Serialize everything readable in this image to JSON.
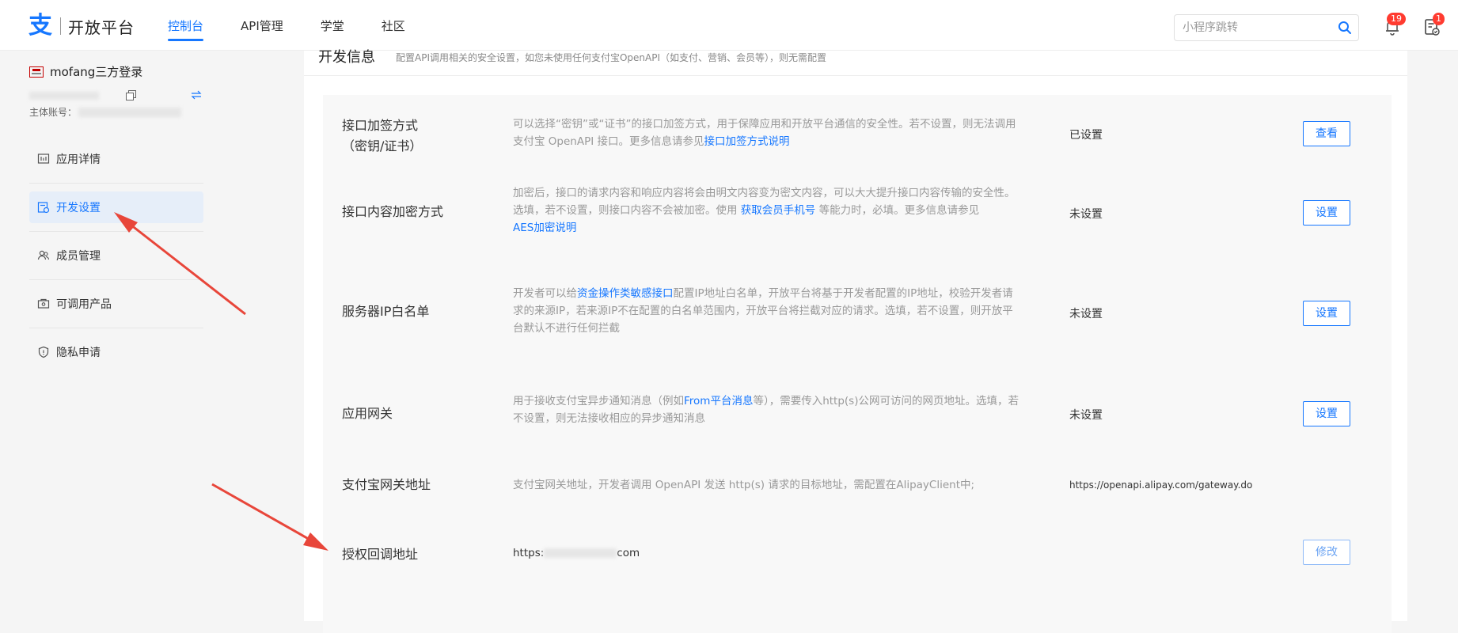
{
  "header": {
    "logo_mark": "支",
    "logo_text": "开放平台",
    "nav": [
      {
        "label": "控制台",
        "active": true
      },
      {
        "label": "API管理",
        "active": false
      },
      {
        "label": "学堂",
        "active": false
      },
      {
        "label": "社区",
        "active": false
      }
    ],
    "search_placeholder": "小程序跳转",
    "notification_count": "19",
    "todo_count": "1"
  },
  "sidebar": {
    "app_name": "mofang三方登录",
    "main_account_label": "主体账号：",
    "menu": [
      {
        "label": "应用详情",
        "icon": "app-detail-icon",
        "active": false
      },
      {
        "label": "开发设置",
        "icon": "dev-settings-icon",
        "active": true
      },
      {
        "label": "成员管理",
        "icon": "members-icon",
        "active": false
      },
      {
        "label": "可调用产品",
        "icon": "products-icon",
        "active": false
      },
      {
        "label": "隐私申请",
        "icon": "privacy-shield-icon",
        "active": false
      }
    ]
  },
  "content": {
    "section_title": "开发信息",
    "section_desc": "配置API调用相关的安全设置，如您未使用任何支付宝OpenAPI（如支付、营销、会员等），则无需配置",
    "rows": [
      {
        "label_line1": "接口加签方式",
        "label_line2": "（密钥/证书）",
        "desc_before": "可以选择“密钥”或“证书”的接口加签方式，用于保障应用和开放平台通信的安全性。若不设置，则无法调用支付宝 OpenAPI 接口。更多信息请参见",
        "desc_link": "接口加签方式说明",
        "status": "已设置",
        "button": "查看"
      },
      {
        "label": "接口内容加密方式",
        "desc_before": "加密后，接口的请求内容和响应内容将会由明文内容变为密文内容，可以大大提升接口内容传输的安全性。选填，若不设置，则接口内容不会被加密。使用 ",
        "desc_link": "获取会员手机号",
        "desc_after": " 等能力时，必填。更多信息请参见",
        "desc_link2": "AES加密说明",
        "status": "未设置",
        "button": "设置"
      },
      {
        "label": "服务器IP白名单",
        "desc_before": "开发者可以给",
        "desc_link": "资金操作类敏感接口",
        "desc_after": "配置IP地址白名单，开放平台将基于开发者配置的IP地址，校验开发者请求的来源IP，若来源IP不在配置的白名单范围内，开放平台将拦截对应的请求。选填，若不设置，则开放平台默认不进行任何拦截",
        "status": "未设置",
        "button": "设置"
      },
      {
        "label": "应用网关",
        "desc_before": "用于接收支付宝异步通知消息（例如",
        "desc_link": "From平台消息",
        "desc_after": "等），需要传入http(s)公网可访问的网页地址。选填，若不设置，则无法接收相应的异步通知消息",
        "status": "未设置",
        "button": "设置"
      },
      {
        "label": "支付宝网关地址",
        "desc": "支付宝网关地址，开发者调用 OpenAPI 发送 http(s) 请求的目标地址，需配置在AlipayClient中;",
        "value": "https://openapi.alipay.com/gateway.do"
      },
      {
        "label": "授权回调地址",
        "value_prefix": "https:",
        "value_suffix": "com",
        "button": "修改"
      }
    ]
  },
  "colors": {
    "accent": "#1677ff",
    "badge": "#ff3b30",
    "annotation_arrow": "#e8463a"
  }
}
